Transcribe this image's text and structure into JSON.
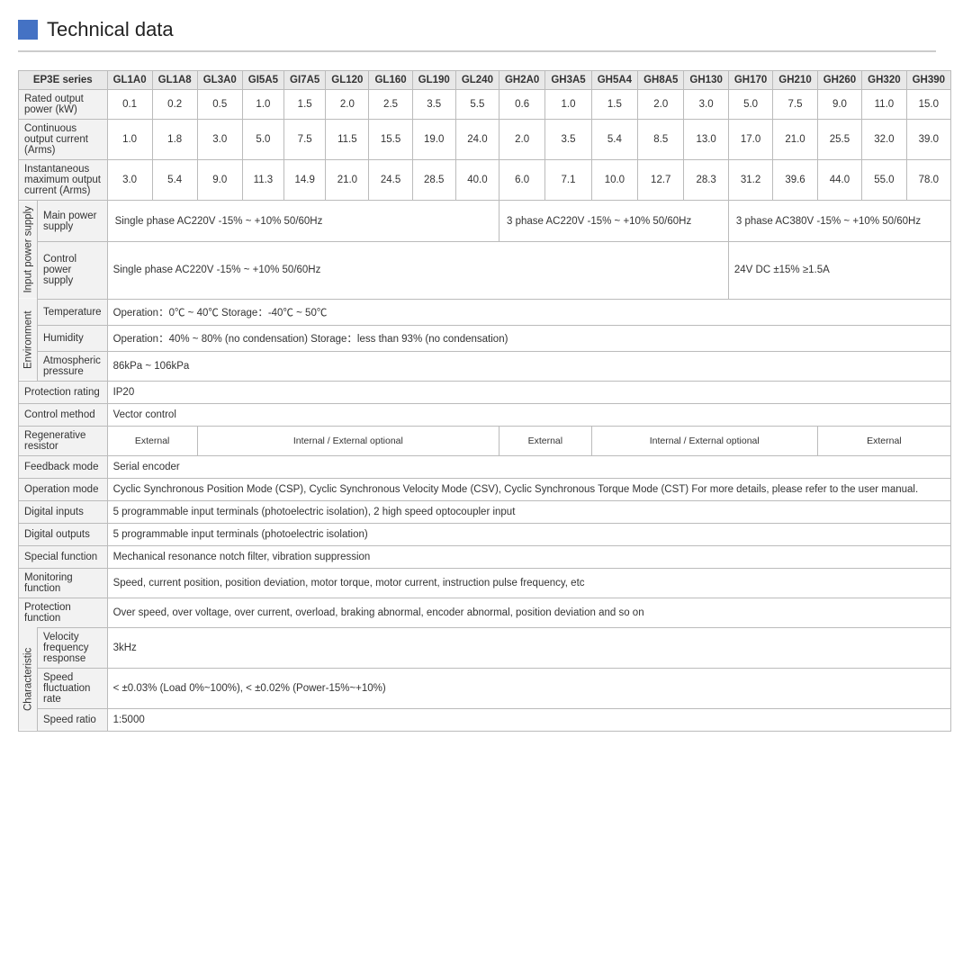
{
  "title": "Technical data",
  "header": {
    "series_label": "EP3E series",
    "models": [
      "GL1A0",
      "GL1A8",
      "GL3A0",
      "GI5A5",
      "GI7A5",
      "GL120",
      "GL160",
      "GL190",
      "GL240",
      "GH2A0",
      "GH3A5",
      "GH5A4",
      "GH8A5",
      "GH130",
      "GH170",
      "GH210",
      "GH260",
      "GH320",
      "GH390"
    ]
  },
  "rows": {
    "rated_output_power": {
      "label": "Rated output power (kW)",
      "values": [
        "0.1",
        "0.2",
        "0.5",
        "1.0",
        "1.5",
        "2.0",
        "2.5",
        "3.5",
        "5.5",
        "0.6",
        "1.0",
        "1.5",
        "2.0",
        "3.0",
        "5.0",
        "7.5",
        "9.0",
        "11.0",
        "15.0"
      ]
    },
    "continuous_output_current": {
      "label": "Continuous output current (Arms)",
      "values": [
        "1.0",
        "1.8",
        "3.0",
        "5.0",
        "7.5",
        "11.5",
        "15.5",
        "19.0",
        "24.0",
        "2.0",
        "3.5",
        "5.4",
        "8.5",
        "13.0",
        "17.0",
        "21.0",
        "25.5",
        "32.0",
        "39.0"
      ]
    },
    "instantaneous_maximum_current": {
      "label": "Instantaneous maximum output current (Arms)",
      "values": [
        "3.0",
        "5.4",
        "9.0",
        "11.3",
        "14.9",
        "21.0",
        "24.5",
        "28.5",
        "40.0",
        "6.0",
        "7.1",
        "10.0",
        "12.7",
        "28.3",
        "31.2",
        "39.6",
        "44.0",
        "55.0",
        "78.0"
      ]
    }
  },
  "input_power_supply": {
    "group_label": "Input power supply",
    "main_power_supply": {
      "label": "Main power supply",
      "col1": "Single phase AC220V -15% ~ +10%  50/60Hz",
      "col2": "3 phase AC220V -15% ~ +10%  50/60Hz",
      "col3": "3 phase AC380V -15% ~ +10%  50/60Hz"
    },
    "control_power_supply": {
      "label": "Control power supply",
      "col1": "Single phase    AC220V   -15%  ~ +10%   50/60Hz",
      "col2": "24V DC    ±15%   ≥1.5A"
    }
  },
  "environment": {
    "group_label": "Environment",
    "temperature": {
      "label": "Temperature",
      "value": "Operation：0℃ ~ 40℃           Storage：-40℃ ~ 50℃"
    },
    "humidity": {
      "label": "Humidity",
      "value": "Operation：40%  ~ 80%  (no condensation)          Storage：less than 93% (no condensation)"
    },
    "atmospheric_pressure": {
      "label": "Atmospheric pressure",
      "value": "86kPa  ~ 106kPa"
    }
  },
  "protection_rating": {
    "label": "Protection rating",
    "value": "IP20"
  },
  "control_method": {
    "label": "Control method",
    "value": "Vector control"
  },
  "regenerative_resistor": {
    "label": "Regenerative resistor",
    "col1": "External",
    "col2": "Internal / External optional",
    "col3": "External",
    "col4": "Internal / External optional",
    "col5": "External"
  },
  "feedback_mode": {
    "label": "Feedback mode",
    "value": "Serial encoder"
  },
  "operation_mode": {
    "label": "Operation mode",
    "value": "Cyclic Synchronous Position Mode (CSP), Cyclic Synchronous Velocity Mode (CSV), Cyclic Synchronous Torque Mode (CST) For more details, please refer to  the user manual."
  },
  "digital_inputs": {
    "label": "Digital inputs",
    "value": "5 programmable input terminals (photoelectric isolation), 2 high speed optocoupler input"
  },
  "digital_outputs": {
    "label": "Digital outputs",
    "value": "5 programmable input terminals (photoelectric isolation)"
  },
  "special_function": {
    "label": "Special function",
    "value": "Mechanical resonance notch filter, vibration suppression"
  },
  "monitoring_function": {
    "label": "Monitoring function",
    "value": "Speed, current position, position deviation, motor torque, motor current, instruction pulse frequency, etc"
  },
  "protection_function": {
    "label": "Protection function",
    "value": "Over speed, over voltage, over current, overload, braking abnormal, encoder abnormal, position deviation and so on"
  },
  "characteristic": {
    "group_label": "Characteristic",
    "velocity_frequency_response": {
      "label": "Velocity frequency response",
      "value": "3kHz"
    },
    "speed_fluctuation_rate": {
      "label": "Speed fluctuation rate",
      "value": "< ±0.03% (Load 0%~100%),   < ±0.02% (Power-15%~+10%)"
    },
    "speed_ratio": {
      "label": "Speed ratio",
      "value": "1:5000"
    }
  }
}
